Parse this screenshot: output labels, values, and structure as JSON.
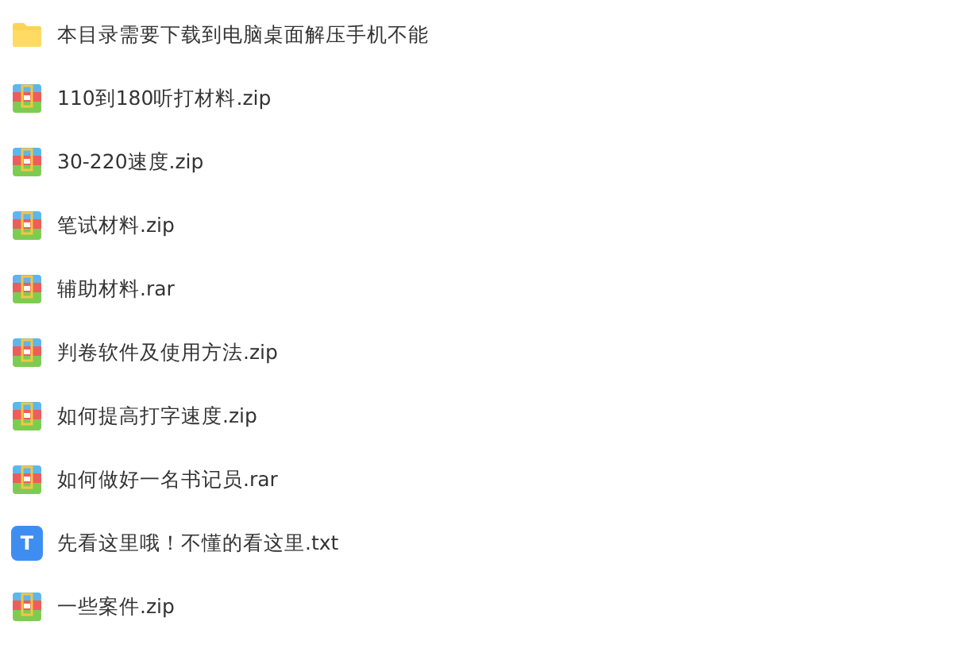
{
  "files": [
    {
      "kind": "folder",
      "name": "本目录需要下载到电脑桌面解压手机不能"
    },
    {
      "kind": "archive",
      "name": "110到180听打材料.zip"
    },
    {
      "kind": "archive",
      "name": "30-220速度.zip"
    },
    {
      "kind": "archive",
      "name": "笔试材料.zip"
    },
    {
      "kind": "archive",
      "name": "辅助材料.rar"
    },
    {
      "kind": "archive",
      "name": "判卷软件及使用方法.zip"
    },
    {
      "kind": "archive",
      "name": "如何提高打字速度.zip"
    },
    {
      "kind": "archive",
      "name": "如何做好一名书记员.rar"
    },
    {
      "kind": "text",
      "name": "先看这里哦！不懂的看这里.txt",
      "icon_letter": "T"
    },
    {
      "kind": "archive",
      "name": "一些案件.zip"
    }
  ]
}
